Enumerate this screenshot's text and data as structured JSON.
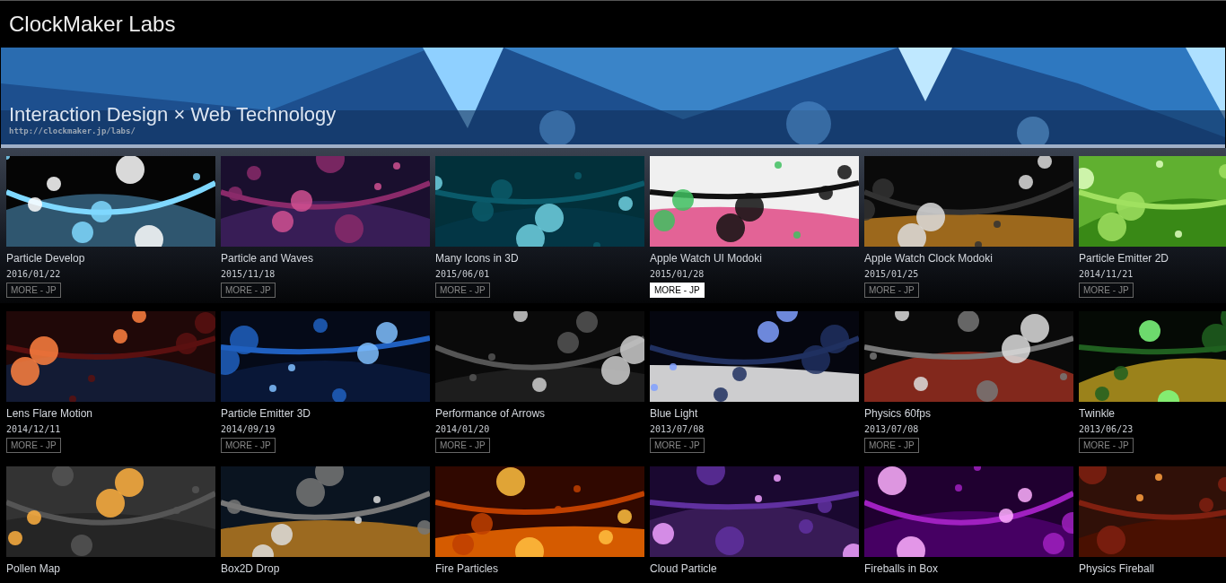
{
  "header": {
    "title": "ClockMaker Labs"
  },
  "banner": {
    "headline": "Interaction Design × Web Technology",
    "url": "http://clockmaker.jp/labs/"
  },
  "rows": [
    {
      "items": [
        {
          "title": "Particle Develop",
          "date": "2016/01/22",
          "more": {
            "label": "MORE - JP",
            "highlighted": false
          }
        },
        {
          "title": "Particle and Waves",
          "date": "2015/11/18",
          "more": {
            "label": "MORE - JP",
            "highlighted": false
          }
        },
        {
          "title": "Many Icons in 3D",
          "date": "2015/06/01",
          "more": {
            "label": "MORE - JP",
            "highlighted": false
          }
        },
        {
          "title": "Apple Watch UI Modoki",
          "date": "2015/01/28",
          "more": {
            "label": "MORE - JP",
            "highlighted": true
          }
        },
        {
          "title": "Apple Watch Clock Modoki",
          "date": "2015/01/25",
          "more": {
            "label": "MORE - JP",
            "highlighted": false
          }
        },
        {
          "title": "Particle Emitter 2D",
          "date": "2014/11/21",
          "more": {
            "label": "MORE - JP",
            "highlighted": false
          }
        }
      ]
    },
    {
      "items": [
        {
          "title": "Lens Flare Motion",
          "date": "2014/12/11",
          "more": {
            "label": "MORE - JP",
            "highlighted": false
          }
        },
        {
          "title": "Particle Emitter 3D",
          "date": "2014/09/19",
          "more": {
            "label": "MORE - JP",
            "highlighted": false
          }
        },
        {
          "title": "Performance of Arrows",
          "date": "2014/01/20",
          "more": {
            "label": "MORE - JP",
            "highlighted": false
          }
        },
        {
          "title": "Blue Light",
          "date": "2013/07/08",
          "more": {
            "label": "MORE - JP",
            "highlighted": false
          }
        },
        {
          "title": "Physics 60fps",
          "date": "2013/07/08",
          "more": {
            "label": "MORE - JP",
            "highlighted": false
          }
        },
        {
          "title": "Twinkle",
          "date": "2013/06/23",
          "more": {
            "label": "MORE - JP",
            "highlighted": false
          }
        }
      ]
    },
    {
      "items": [
        {
          "title": "Pollen Map"
        },
        {
          "title": "Box2D Drop"
        },
        {
          "title": "Fire Particles"
        },
        {
          "title": "Cloud Particle"
        },
        {
          "title": "Fireballs in Box"
        },
        {
          "title": "Physics Fireball"
        }
      ]
    }
  ]
}
